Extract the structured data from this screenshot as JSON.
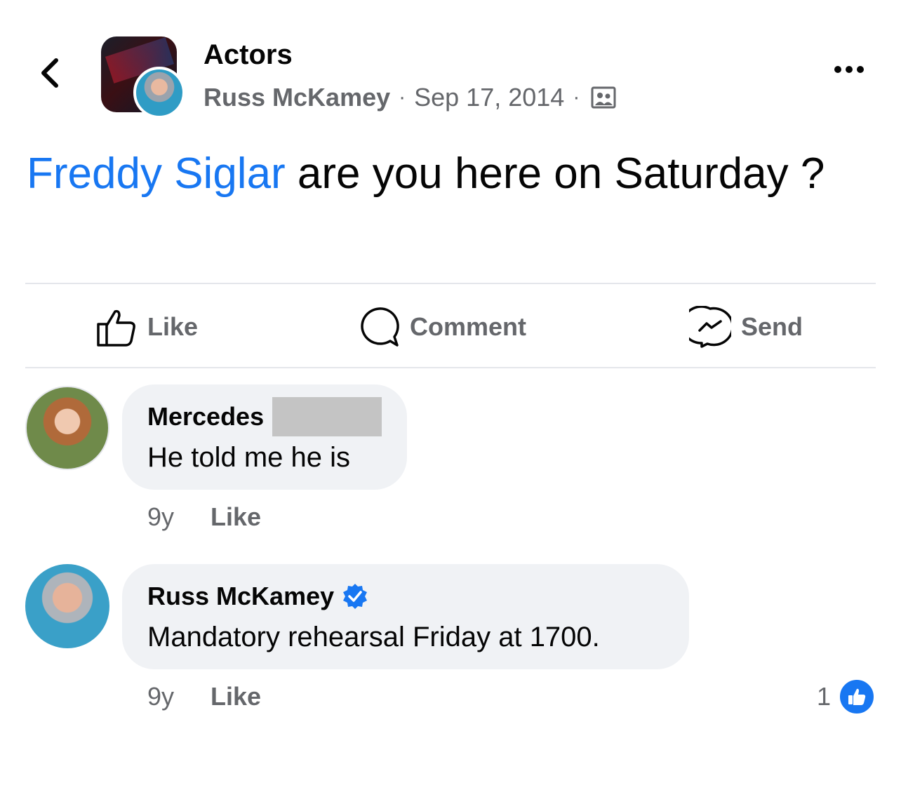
{
  "header": {
    "group_name": "Actors",
    "author": "Russ McKamey",
    "separator": "·",
    "date": "Sep 17, 2014",
    "audience_icon": "group-members-icon"
  },
  "post": {
    "mention": "Freddy Siglar",
    "text": " are you here on Saturday ?"
  },
  "actions": {
    "like": "Like",
    "comment": "Comment",
    "send": "Send"
  },
  "comments": [
    {
      "name": "Mercedes",
      "name_redacted": true,
      "text": "He told me he is",
      "age": "9y",
      "like": "Like"
    },
    {
      "name": "Russ McKamey",
      "verified": true,
      "text": "Mandatory rehearsal Friday at 1700.",
      "age": "9y",
      "like": "Like",
      "reaction_count": "1",
      "reaction_icon": "like-reaction-icon"
    }
  ],
  "colors": {
    "mention": "#1877f2",
    "secondary_text": "#65676b",
    "bubble": "#f0f2f5",
    "verified": "#1877f2"
  }
}
